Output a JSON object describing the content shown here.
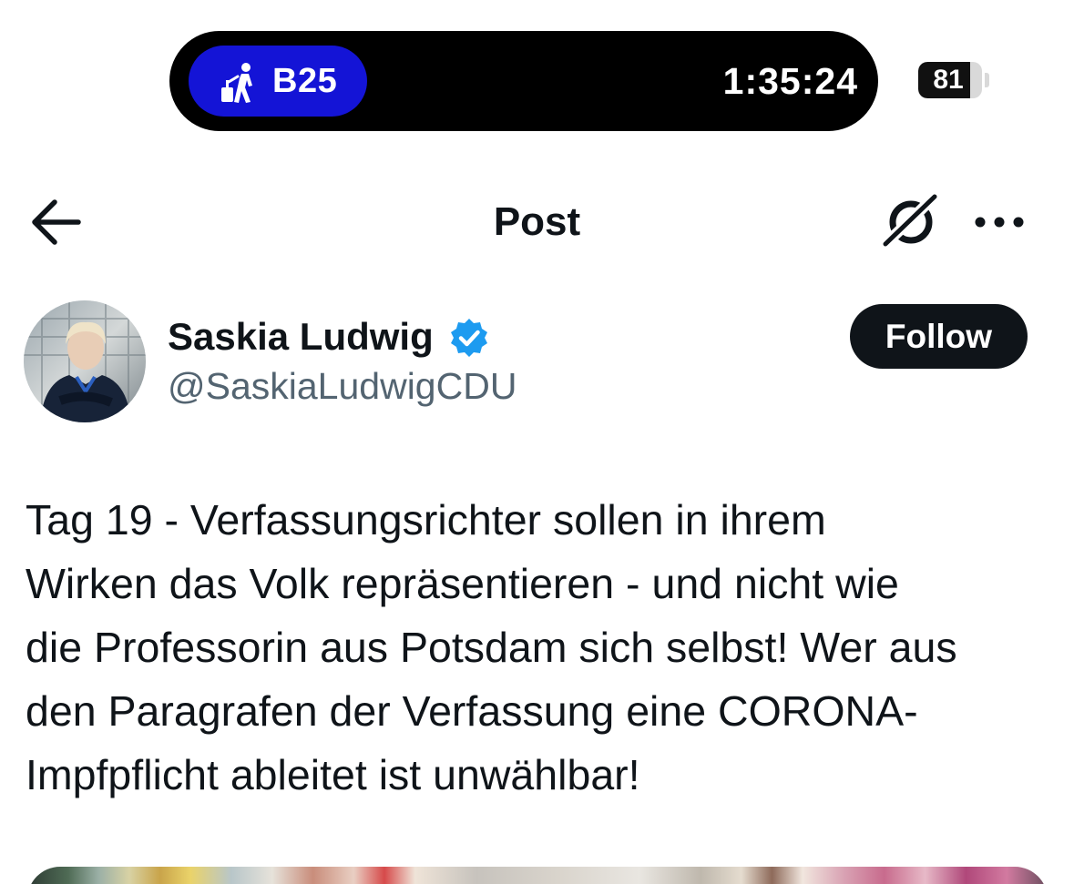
{
  "status_bar": {
    "gate": "B25",
    "timer": "1:35:24",
    "battery_level": "81",
    "battery_fraction": 0.81,
    "gate_icon": "traveler-with-luggage-icon"
  },
  "nav": {
    "title": "Post",
    "back_icon": "arrow-left-icon",
    "grok_icon": "grok-icon",
    "more_icon": "more-horizontal-icon"
  },
  "author": {
    "name": "Saskia Ludwig",
    "handle": "@SaskiaLudwigCDU",
    "verified": true,
    "follow_label": "Follow"
  },
  "post": {
    "lines": [
      "Tag 19 - Verfassungsrichter sollen in ihrem",
      "Wirken das Volk repräsentieren - und nicht wie",
      "die Professorin aus Potsdam sich selbst! Wer aus",
      "den Paragrafen der Verfassung eine CORONA-",
      "Impfpflicht ableitet ist unwählbar!"
    ]
  },
  "colors": {
    "gate_pill": "#1414d6",
    "verified_badge": "#1d9bf0",
    "handle_text": "#536471",
    "follow_button": "#0f1419"
  }
}
